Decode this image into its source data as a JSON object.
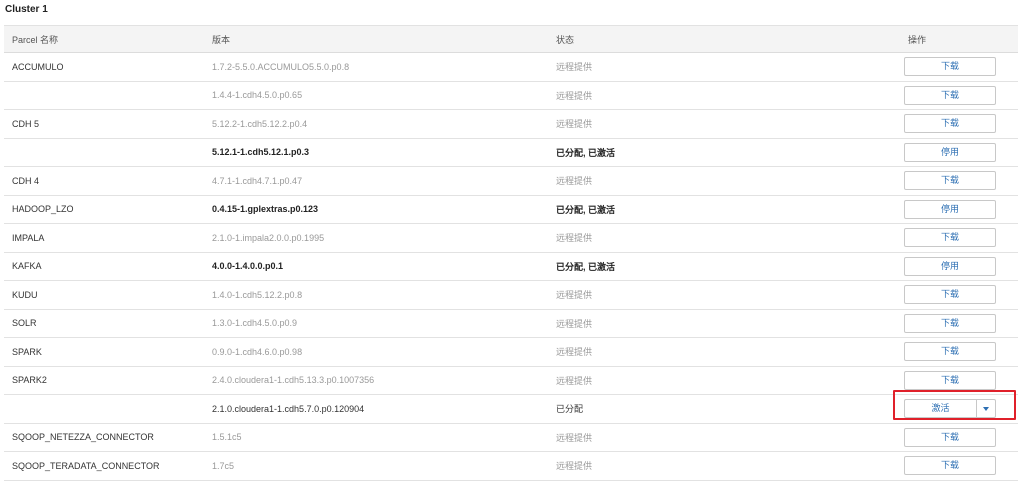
{
  "cluster": {
    "title": "Cluster 1"
  },
  "table": {
    "headers": {
      "name": "Parcel 名称",
      "version": "版本",
      "status": "状态",
      "action": "操作"
    },
    "rows": [
      {
        "name": "ACCUMULO",
        "version": "1.7.2-5.5.0.ACCUMULO5.5.0.p0.8",
        "status": "远程提供",
        "action": "下载"
      },
      {
        "name": "",
        "version": "1.4.4-1.cdh4.5.0.p0.65",
        "status": "远程提供",
        "action": "下载"
      },
      {
        "name": "CDH 5",
        "version": "5.12.2-1.cdh5.12.2.p0.4",
        "status": "远程提供",
        "action": "下载"
      },
      {
        "name": "",
        "version": "5.12.1-1.cdh5.12.1.p0.3",
        "status": "已分配, 已激活",
        "action": "停用"
      },
      {
        "name": "CDH 4",
        "version": "4.7.1-1.cdh4.7.1.p0.47",
        "status": "远程提供",
        "action": "下载"
      },
      {
        "name": "HADOOP_LZO",
        "version": "0.4.15-1.gplextras.p0.123",
        "status": "已分配, 已激活",
        "action": "停用"
      },
      {
        "name": "IMPALA",
        "version": "2.1.0-1.impala2.0.0.p0.1995",
        "status": "远程提供",
        "action": "下载"
      },
      {
        "name": "KAFKA",
        "version": "4.0.0-1.4.0.0.p0.1",
        "status": "已分配, 已激活",
        "action": "停用"
      },
      {
        "name": "KUDU",
        "version": "1.4.0-1.cdh5.12.2.p0.8",
        "status": "远程提供",
        "action": "下载"
      },
      {
        "name": "SOLR",
        "version": "1.3.0-1.cdh4.5.0.p0.9",
        "status": "远程提供",
        "action": "下载"
      },
      {
        "name": "SPARK",
        "version": "0.9.0-1.cdh4.6.0.p0.98",
        "status": "远程提供",
        "action": "下载"
      },
      {
        "name": "SPARK2",
        "version": "2.4.0.cloudera1-1.cdh5.13.3.p0.1007356",
        "status": "远程提供",
        "action": "下载"
      },
      {
        "name": "",
        "version": "2.1.0.cloudera1-1.cdh5.7.0.p0.120904",
        "status": "已分配",
        "action": "激活"
      },
      {
        "name": "SQOOP_NETEZZA_CONNECTOR",
        "version": "1.5.1c5",
        "status": "远程提供",
        "action": "下载"
      },
      {
        "name": "SQOOP_TERADATA_CONNECTOR",
        "version": "1.7c5",
        "status": "远程提供",
        "action": "下载"
      }
    ]
  },
  "colors": {
    "link": "#2d6fb3",
    "highlight": "#e0202a",
    "header_bg": "#f4f4f4"
  },
  "icons": {
    "dropdown": "caret-down-icon"
  }
}
